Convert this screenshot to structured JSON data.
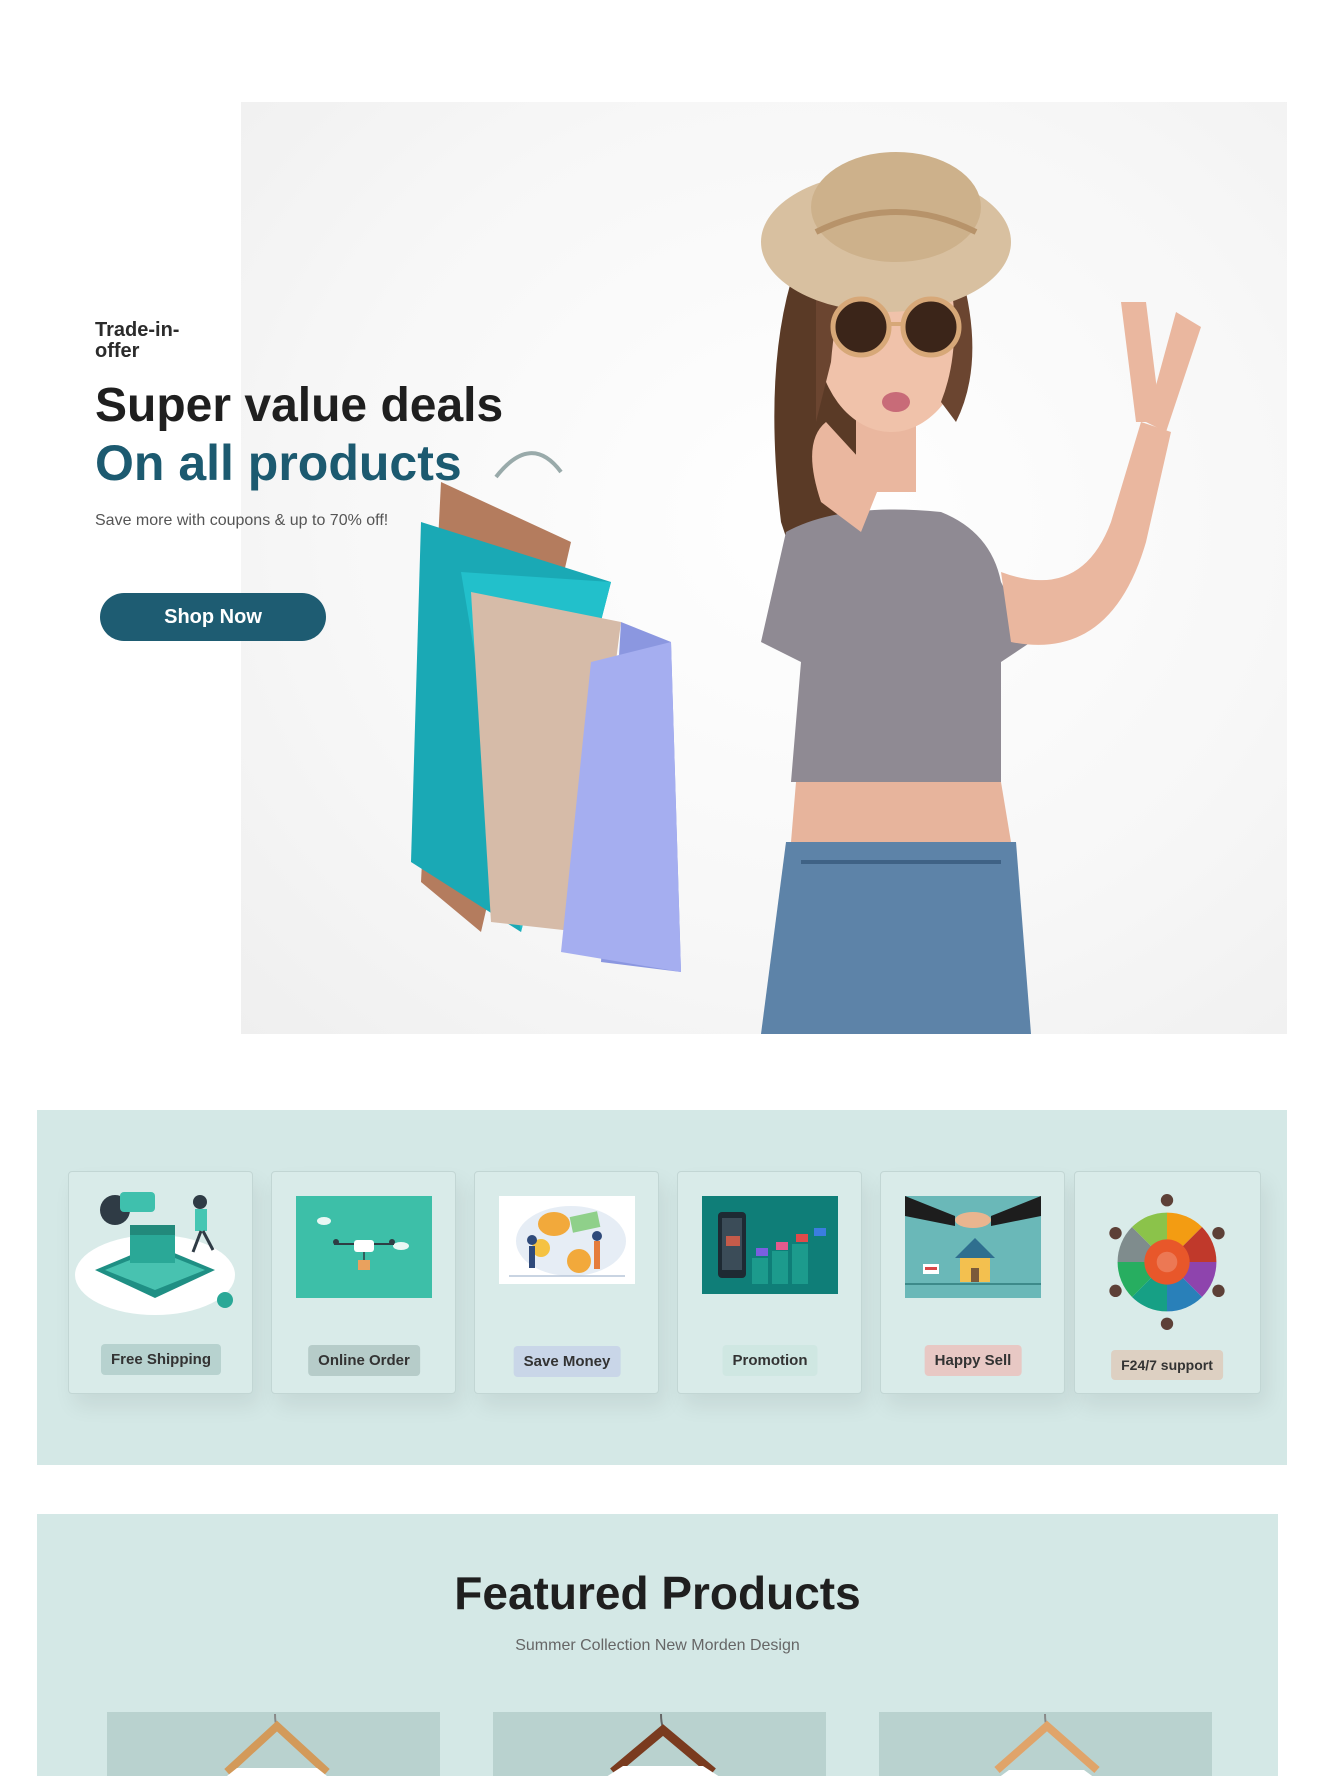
{
  "hero": {
    "tag": "Trade-in-offer",
    "headline_1": "Super value deals",
    "headline_2": "On all products",
    "subtitle": "Save more with coupons & up to 70% off!",
    "cta_label": "Shop Now"
  },
  "features": [
    {
      "label": "Free Shipping",
      "label_bg": "#b7d2cf",
      "icon": "free-shipping-illustration"
    },
    {
      "label": "Online Order",
      "label_bg": "#b6ccc9",
      "icon": "drone-delivery-illustration"
    },
    {
      "label": "Save Money",
      "label_bg": "#c9d6e8",
      "icon": "save-money-illustration"
    },
    {
      "label": "Promotion",
      "label_bg": "#cfe7e2",
      "icon": "promotion-illustration"
    },
    {
      "label": "Happy Sell",
      "label_bg": "#e8c8c4",
      "icon": "handshake-house-illustration"
    },
    {
      "label": "F24/7 support",
      "label_bg": "#ddd0c2",
      "icon": "support-circle-illustration"
    }
  ],
  "featured": {
    "title": "Featured Products",
    "subtitle": "Summer Collection New Morden Design"
  },
  "colors": {
    "brand": "#1e5c72",
    "section_bg": "#d4e8e6"
  }
}
